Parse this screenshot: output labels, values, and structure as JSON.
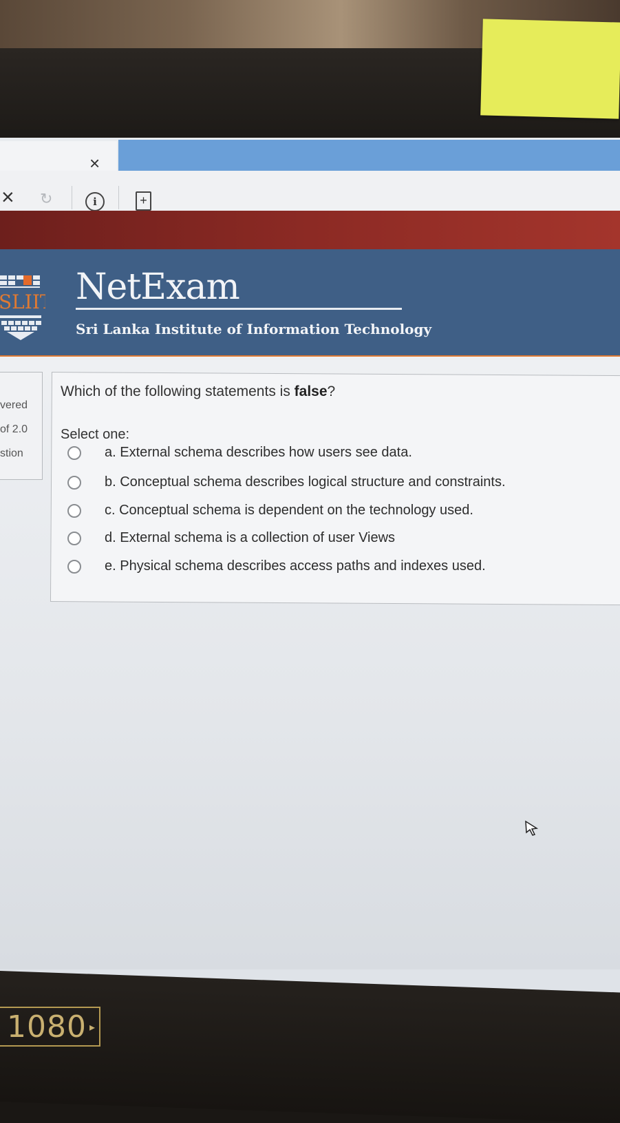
{
  "browser": {
    "tab_close": "×",
    "toolbar": {
      "stop": "×",
      "reload": "↻",
      "info": "i",
      "page": "+"
    }
  },
  "header": {
    "logo_text": "SLIIT",
    "title": "NetExam",
    "subtitle": "Sri Lanka Institute of Information Technology",
    "colors": {
      "band": "#3f5f86",
      "accent": "#e07a32",
      "top_band": "#8c2a24"
    }
  },
  "sidebar": {
    "lines": [
      "vered",
      "of 2.0",
      "stion"
    ]
  },
  "question": {
    "text_prefix": "Which of the following statements is ",
    "text_bold": "false",
    "text_suffix": "?",
    "prompt": "Select one:",
    "options": [
      {
        "label": "a. External schema describes how users see data.",
        "selected": false
      },
      {
        "label": "b. Conceptual schema describes logical structure and constraints.",
        "selected": false
      },
      {
        "label": "c. Conceptual schema is dependent on the technology used.",
        "selected": false
      },
      {
        "label": "d. External schema is a collection of user Views",
        "selected": false
      },
      {
        "label": "e. Physical schema describes access paths and indexes used.",
        "selected": false
      }
    ]
  },
  "monitor_badge": {
    "text": "1080"
  }
}
